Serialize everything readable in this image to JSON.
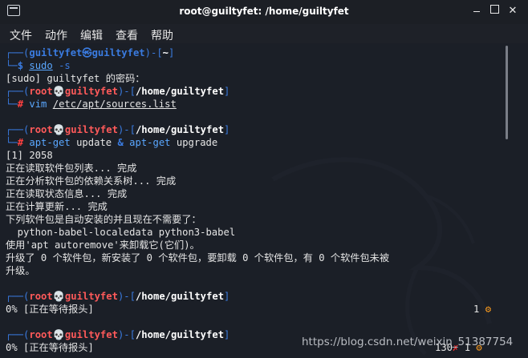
{
  "window": {
    "title": "root@guiltyfet: /home/guiltyfet"
  },
  "menu": [
    "文件",
    "动作",
    "编辑",
    "查看",
    "帮助"
  ],
  "lines": {
    "l1_frame": "┌──(",
    "l1_user": "guiltyfet",
    "l1_at": "㉿",
    "l1_host": "guiltyfet",
    "l1_mid": ")-[",
    "l1_path": "~",
    "l1_end": "]",
    "l2_frame": "└─",
    "l2_prompt": "$",
    "l2_cmd": "sudo",
    "l2_arg": "-s",
    "l3": "[sudo] guiltyfet 的密码：",
    "p1_frame": "┌──(",
    "p1_user": "root",
    "p1_skull": "💀",
    "p1_host": "guiltyfet",
    "p1_mid": ")-[",
    "p1_path": "/home/guiltyfet",
    "p1_end": "]",
    "c1_frame": "└─",
    "c1_prompt": "#",
    "c1_cmd": "vim",
    "c1_arg": "/etc/apt/sources.list",
    "p2_user": "root",
    "p2_host": "guiltyfet",
    "p2_path": "/home/guiltyfet",
    "c2_cmd1": "apt-get",
    "c2_arg1": "update",
    "c2_amp": "&",
    "c2_cmd2": "apt-get",
    "c2_arg2": "upgrade",
    "o1": "[1] 2058",
    "o2": "正在读取软件包列表... 完成",
    "o3": "正在分析软件包的依赖关系树... 完成",
    "o4": "正在读取状态信息... 完成",
    "o5": "正在计算更新... 完成",
    "o6": "下列软件包是自动安装的并且现在不需要了：",
    "o7": "  python-babel-localedata python3-babel",
    "o8": "使用'apt autoremove'来卸载它(它们)。",
    "o9": "升级了 0 个软件包，新安装了 0 个软件包，要卸载 0 个软件包，有 0 个软件包未被",
    "o10": "升级。",
    "p3_user": "root",
    "p3_host": "guiltyfet",
    "p3_path": "/home/guiltyfet",
    "c3_text": "0% [正在等待报头]",
    "c3_right": "1",
    "p4_user": "root",
    "p4_host": "guiltyfet",
    "p4_path": "/home/guiltyfet",
    "c4_text": "0% [正在等待报头]",
    "c4_right_code": "130",
    "c4_right_x": "✗",
    "c4_right_jobs": "1"
  },
  "watermark": "https://blog.csdn.net/weixin_51387754",
  "icons": {
    "gear": "gear-icon",
    "skull": "skull-icon"
  },
  "colors": {
    "background": "#1b1f27",
    "frame_blue": "#3a7be0",
    "root_red": "#ff5a5a",
    "gear_orange": "#ff9d1e"
  }
}
